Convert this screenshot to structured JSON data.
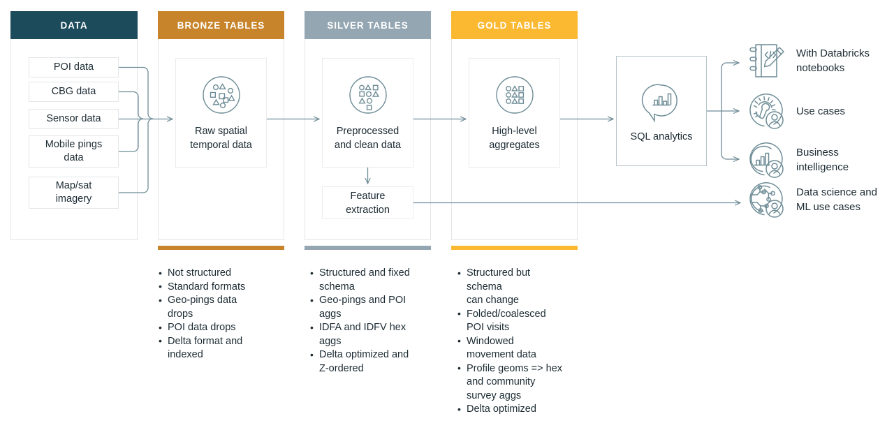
{
  "columns": [
    {
      "id": "data",
      "title": "DATA",
      "header_color": "#1c4b5c",
      "rule_color": null
    },
    {
      "id": "bronze",
      "title": "BRONZE TABLES",
      "header_color": "#c8842a",
      "rule_color": "#c8842a"
    },
    {
      "id": "silver",
      "title": "SILVER TABLES",
      "header_color": "#93a6b2",
      "rule_color": "#93a6b2"
    },
    {
      "id": "gold",
      "title": "GOLD TABLES",
      "header_color": "#fbb831",
      "rule_color": "#fbb831"
    }
  ],
  "sources": [
    {
      "label": "POI data"
    },
    {
      "label": "CBG data"
    },
    {
      "label": "Sensor data"
    },
    {
      "label": "Mobile pings\ndata"
    },
    {
      "label": "Map/sat\nimagery"
    }
  ],
  "cards": {
    "bronze": {
      "caption": "Raw spatial\ntemporal data",
      "icon": "scattered-shapes-icon"
    },
    "silver": {
      "caption": "Preprocessed\nand clean data",
      "icon": "semi-ordered-shapes-icon"
    },
    "gold": {
      "caption": "High-level\naggregates",
      "icon": "ordered-shapes-grid-icon"
    },
    "feature": {
      "caption": "Feature\nextraction"
    },
    "sql": {
      "caption": "SQL analytics",
      "icon": "chart-bubble-icon"
    }
  },
  "bullet_lists": {
    "bronze": [
      "Not structured",
      "Standard formats",
      "Geo-pings data\ndrops",
      "POI data drops",
      "Delta format and\nindexed"
    ],
    "silver": [
      "Structured and fixed\nschema",
      "Geo-pings and POI\naggs",
      "IDFA and IDFV hex\naggs",
      "Delta optimized and\nZ-ordered"
    ],
    "gold": [
      "Structured but\nschema\ncan change",
      "Folded/coalesced\nPOI visits",
      "Windowed\nmovement data",
      "Profile geoms => hex\nand community\nsurvey aggs",
      "Delta optimized"
    ]
  },
  "outputs": [
    {
      "label": "With Databricks\nnotebooks",
      "icon": "notebook-code-pencil-icon"
    },
    {
      "label": "Use cases",
      "icon": "gear-wrench-person-icon"
    },
    {
      "label": "Business\nintelligence",
      "icon": "bar-chart-person-icon"
    },
    {
      "label": "Data science and\nML use cases",
      "icon": "network-nodes-person-icon"
    }
  ],
  "theme": {
    "line_color": "#6e8c96",
    "icon_stroke": "#6e8c96",
    "text_color": "#1b2a32",
    "panel_border": "#e3e6e8"
  }
}
